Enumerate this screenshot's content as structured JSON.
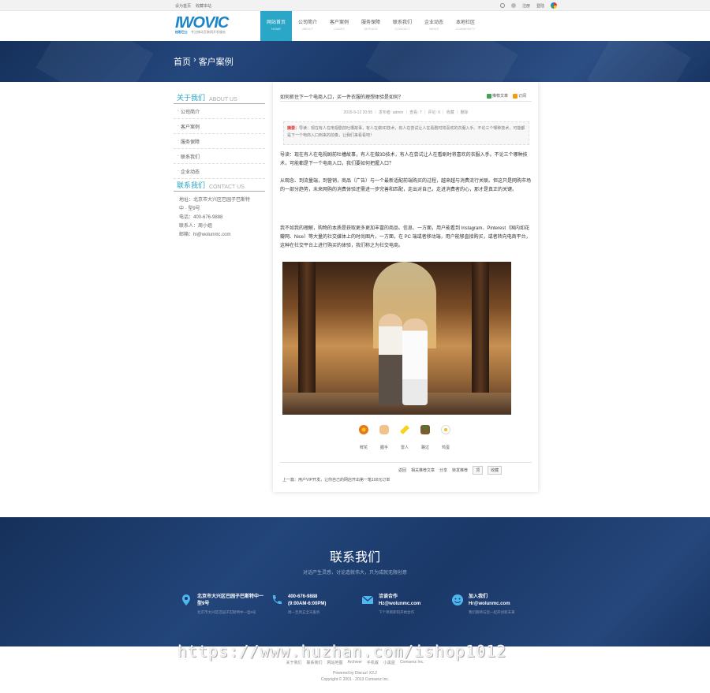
{
  "topbar": {
    "left_links": [
      "设为首页",
      "收藏本站"
    ],
    "right_links": [
      "注册",
      "登陆"
    ]
  },
  "logo": {
    "text": "IWOVIC",
    "sub_cn": "炫彩巴士",
    "sub_tag": "专注移动互联网开发服务"
  },
  "nav": [
    {
      "cn": "网站首页",
      "en": "HOME",
      "active": true
    },
    {
      "cn": "公司简介",
      "en": "ABOUT"
    },
    {
      "cn": "客户案例",
      "en": "CASES"
    },
    {
      "cn": "服务保障",
      "en": "SERVICE"
    },
    {
      "cn": "联系我们",
      "en": "CONTACT"
    },
    {
      "cn": "企业动态",
      "en": "NEWS"
    },
    {
      "cn": "本地社区",
      "en": "COMMUNITY"
    }
  ],
  "breadcrumb": {
    "home": "首页",
    "sep": "›",
    "current": "客户案例"
  },
  "sidebar": {
    "about_title": "关于我们",
    "about_title_en": "ABOUT US",
    "items": [
      "公司简介",
      "客户案例",
      "服务保障",
      "联系我们",
      "企业动态"
    ],
    "contact_title": "联系我们",
    "contact_title_en": "CONTACT US",
    "contact_lines": [
      "地址：北京市大兴区巴园子巴斯特",
      "中 · 型9号",
      "电话：400-676-9888",
      "联系人：周小姐",
      "邮箱：hi@wolunmc.com"
    ]
  },
  "article": {
    "title": "如何抓住下一个电商入口，买一件衣服的理想体验是如何？",
    "tools": [
      "推荐文章",
      "订阅"
    ],
    "meta": "2015-9-12 20:55 ｜ 发布者: admin ｜ 查看: 7 ｜ 评论: 0 ｜ 收藏 ｜ 删除",
    "summary_label": "摘要：",
    "summary": "导读：现在有人在电视剧前吐槽故事，有人在做3D技术，有人在尝试让人在看剧时将喜欢的衣服入手。不论三个哪种技术，可能都是下一个电商入口到来的前奏，让我们来看看吧！",
    "paragraphs": [
      "导读：现在有人在电视剧前吐槽故事，有人在做3D技术，有人在尝试让人在看剧时将喜欢的衣服入手。不论三个哪种技术，可能都是下一个电商入口，我们要如何把握入口？",
      "从观念、到流量端，到营销，商品（广告）与一个最新适配前端购买的过程，越来越与消费流行关联。但这只是网购市场的一部分趋势，未来网购的消费体验还需进一步完善和匹配，走出对自己，走进消费者的心，那才是真正的关键。",
      "我不如我的理解，购物的本质是获取更多更加丰富的商品、信息、一方面，用户能看到 Instagram、Pinterest（国内如花瓣网、Nice）等大量的社交媒体上的时尚图片，一方面，在 PC 端或者移动端，用户能够直接购买，或者转向电商平台，这种在社交平台上进行购买的体验，我们称之为社交电商。"
    ],
    "moods": [
      "鲜花",
      "握手",
      "雷人",
      "路过",
      "鸡蛋"
    ],
    "bottom_links": [
      "返回",
      "相关推荐文章",
      "分享",
      "转发推荐"
    ],
    "bottom_buttons": [
      "顶",
      "收藏"
    ],
    "prev": "上一篇：用户VIP开发，让你自己的网店开出第一笔100元订单"
  },
  "footer": {
    "title": "联系我们",
    "subtitle": "对话产生灵感，讨论造就伟大，只为成就无限创意",
    "columns": [
      {
        "icon": "location-icon",
        "title": "北京市大兴区巴园子巴斯特中一型9号",
        "desc": "北京市大兴区巴园子巴斯特中一型9号"
      },
      {
        "icon": "phone-icon",
        "title": "400-676-9888",
        "title2": "(9:00AM-6:00PM)",
        "desc": "周一至周五全天服务"
      },
      {
        "icon": "mail-icon",
        "title": "洽谈合作",
        "title2": "Hz@wolunmc.com",
        "desc": "下个项目即刻开始合作"
      },
      {
        "icon": "smile-icon",
        "title": "加入我们",
        "title2": "Hr@wolunmc.com",
        "desc": "我们期待与您一起开创新未来"
      }
    ]
  },
  "copyright": {
    "links": [
      "关于我们",
      "联系我们",
      "网站地图",
      "Archiver",
      "手机版",
      "小黑屋",
      "Comsenz Inc."
    ],
    "powered": "Powered by Discuz! X3.2",
    "copy": "Copyright © 2001 - 2013 Comsenz Inc."
  },
  "watermark": "https://www.huzhan.com/ishop1012",
  "colors": {
    "accent": "#2aa6c7",
    "navy": "#1a3868",
    "logo": "#1a86c9"
  }
}
